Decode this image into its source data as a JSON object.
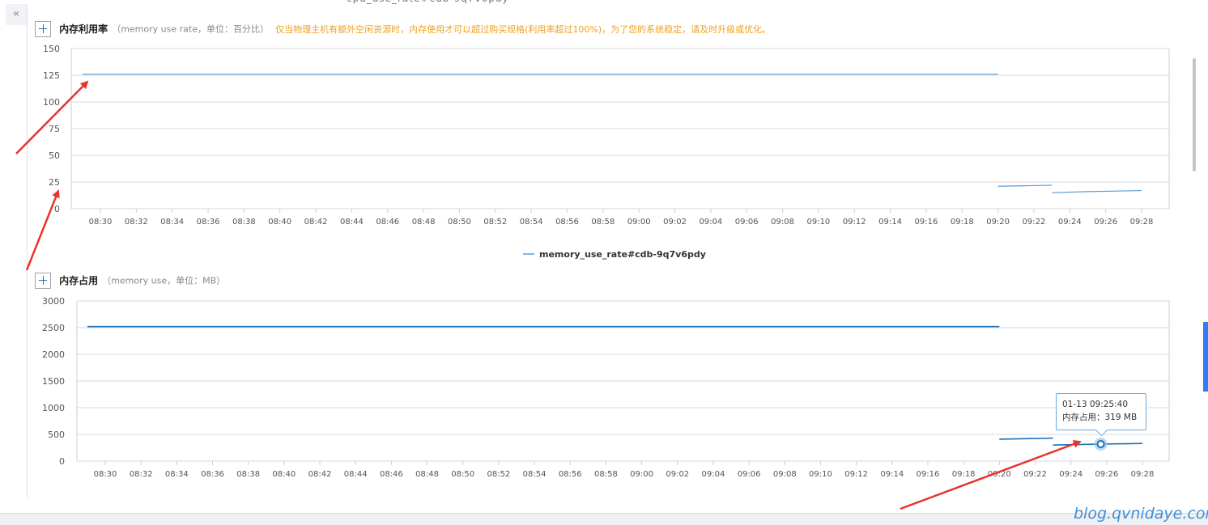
{
  "nav": {
    "collapse_glyph": "«"
  },
  "charts": {
    "rate": {
      "title": "内存利用率",
      "subtitle": "（memory use rate，单位：百分比）",
      "warning": "仅当物理主机有额外空闲资源时，内存使用才可以超过购买规格(利用率超过100%)，为了您的系统稳定，请及时升级或优化。",
      "legend": "memory_use_rate#cdb-9q7v6pdy"
    },
    "usage": {
      "title": "内存占用",
      "subtitle": "（memory use，单位：MB）"
    }
  },
  "tooltip": {
    "time": "01-13 09:25:40",
    "value": "内存占用：319 MB"
  },
  "watermark": "blog.qvnidaye.com",
  "chart_data": [
    {
      "type": "line",
      "title": "内存利用率",
      "ylabel": "",
      "xlabel": "",
      "ylim": [
        0,
        150
      ],
      "yticks": [
        0,
        25,
        50,
        75,
        100,
        125,
        150
      ],
      "xticks": [
        "08:30",
        "08:32",
        "08:34",
        "08:36",
        "08:38",
        "08:40",
        "08:42",
        "08:44",
        "08:46",
        "08:48",
        "08:50",
        "08:52",
        "08:54",
        "08:56",
        "08:58",
        "09:00",
        "09:02",
        "09:04",
        "09:06",
        "09:08",
        "09:10",
        "09:12",
        "09:14",
        "09:16",
        "09:18",
        "09:20",
        "09:22",
        "09:24",
        "09:26",
        "09:28"
      ],
      "grid": true,
      "legend": "bottom-center",
      "series": [
        {
          "name": "memory_use_rate#cdb-9q7v6pdy",
          "color": "#5b9bd5",
          "segments": [
            {
              "x": [
                "08:29",
                "09:20"
              ],
              "y": [
                126,
                126
              ]
            },
            {
              "x": [
                "09:20",
                "09:23"
              ],
              "y": [
                21,
                22
              ]
            },
            {
              "x": [
                "09:23",
                "09:25",
                "09:28"
              ],
              "y": [
                15,
                16,
                17
              ]
            }
          ]
        }
      ]
    },
    {
      "type": "line",
      "title": "内存占用",
      "ylabel": "",
      "xlabel": "",
      "ylim": [
        0,
        3000
      ],
      "yticks": [
        0,
        500,
        1000,
        1500,
        2000,
        2500,
        3000
      ],
      "xticks": [
        "08:30",
        "08:32",
        "08:34",
        "08:36",
        "08:38",
        "08:40",
        "08:42",
        "08:44",
        "08:46",
        "08:48",
        "08:50",
        "08:52",
        "08:54",
        "08:56",
        "08:58",
        "09:00",
        "09:02",
        "09:04",
        "09:06",
        "09:08",
        "09:10",
        "09:12",
        "09:14",
        "09:16",
        "09:18",
        "09:20",
        "09:22",
        "09:24",
        "09:26",
        "09:28"
      ],
      "grid": true,
      "series": [
        {
          "name": "",
          "color": "#1f6fb8",
          "segments": [
            {
              "x": [
                "08:29",
                "09:20"
              ],
              "y": [
                2520,
                2520
              ]
            },
            {
              "x": [
                "09:20",
                "09:23"
              ],
              "y": [
                410,
                430
              ]
            },
            {
              "x": [
                "09:23",
                "09:25.67",
                "09:28"
              ],
              "y": [
                300,
                319,
                330
              ]
            }
          ],
          "highlight": {
            "x": "09:25.67",
            "y": 319
          }
        }
      ]
    }
  ]
}
